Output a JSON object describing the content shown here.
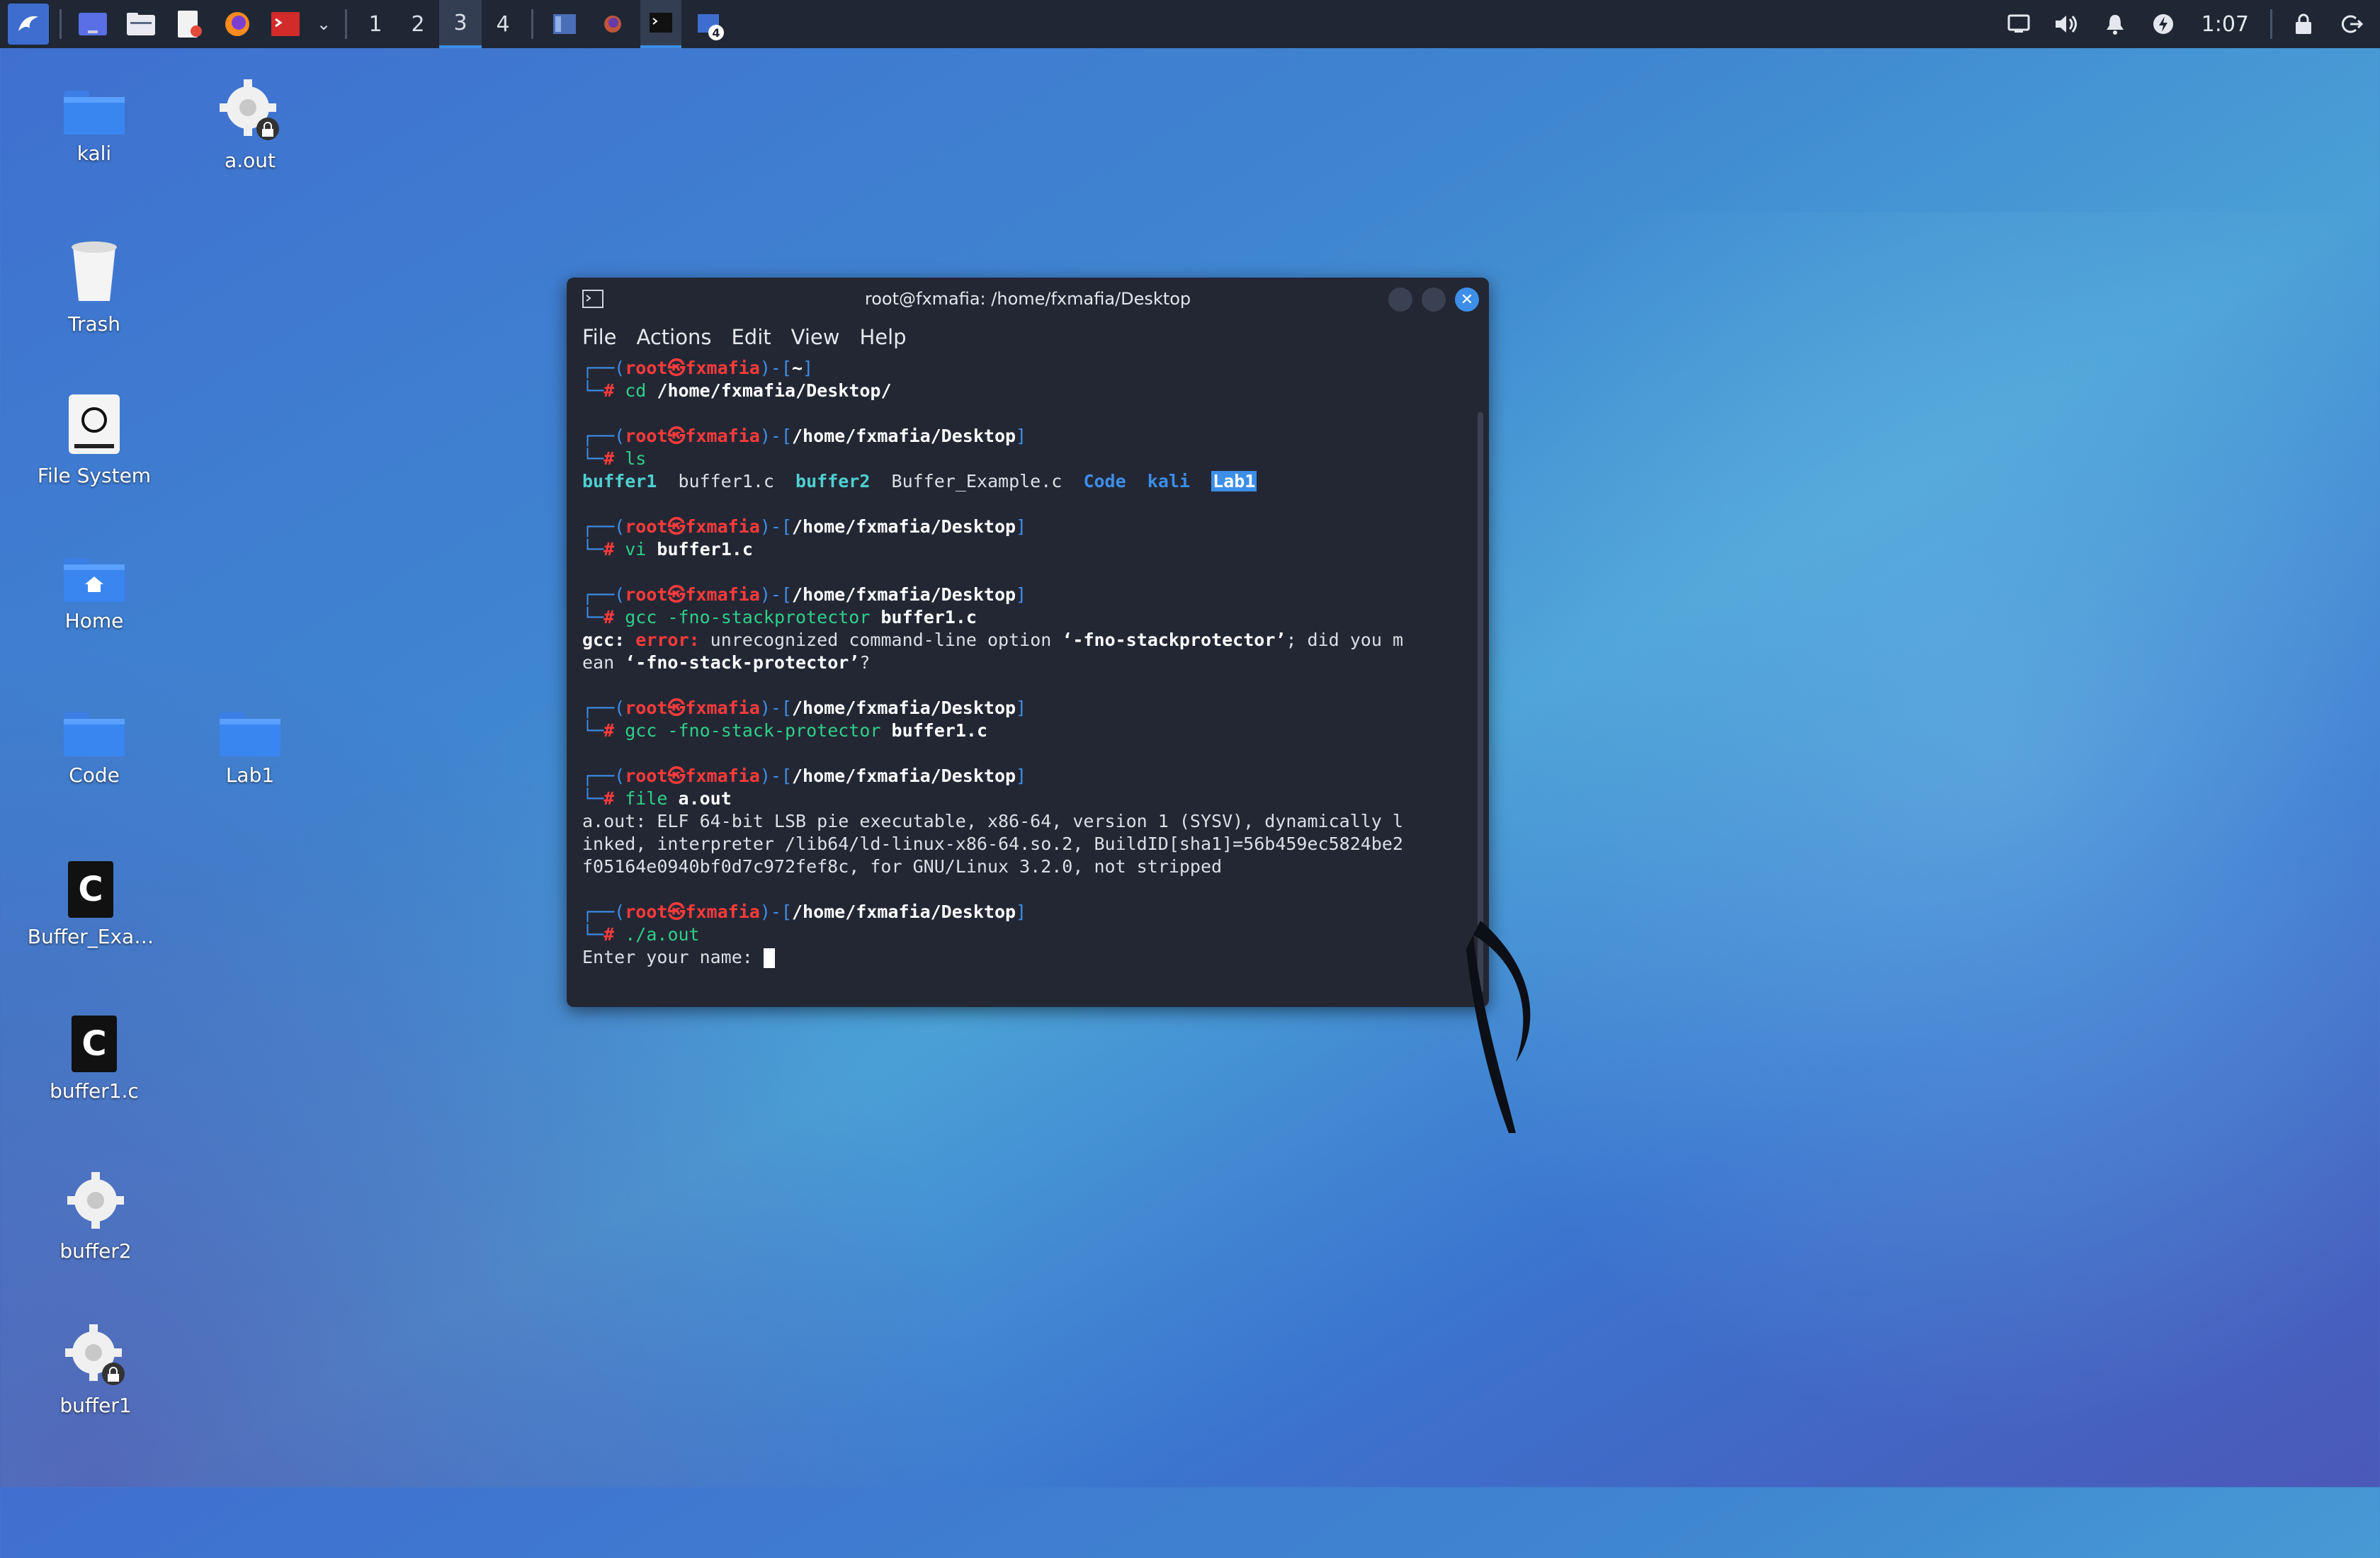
{
  "taskbar": {
    "workspaces": [
      "1",
      "2",
      "3",
      "4"
    ],
    "active_workspace": "3",
    "notification_badge": "4",
    "clock": "1:07"
  },
  "desktop_icons": {
    "kali": "kali",
    "aout": "a.out",
    "trash": "Trash",
    "filesystem": "File System",
    "home": "Home",
    "code": "Code",
    "lab1": "Lab1",
    "buffer_example": "Buffer_Exa…",
    "buffer1c": "buffer1.c",
    "buffer2": "buffer2",
    "buffer1": "buffer1"
  },
  "terminal": {
    "title": "root@fxmafia: /home/fxmafia/Desktop",
    "menu": [
      "File",
      "Actions",
      "Edit",
      "View",
      "Help"
    ],
    "user": "root",
    "host": "fxmafia",
    "home_dir": "~",
    "desktop_dir": "/home/fxmafia/Desktop",
    "cmd1_name": "cd",
    "cmd1_arg": "/home/fxmafia/Desktop/",
    "cmd2": "ls",
    "ls_out": {
      "a": "buffer1",
      "b": "buffer1.c",
      "c": "buffer2",
      "d": "Buffer_Example.c",
      "e": "Code",
      "f": "kali",
      "g": "Lab1"
    },
    "cmd3_name": "vi",
    "cmd3_arg": "buffer1.c",
    "cmd4_name": "gcc -fno-stackprotector",
    "cmd4_arg": "buffer1.c",
    "gcc_err_prefix": "gcc:",
    "gcc_err_word": "error:",
    "gcc_err_text": "unrecognized command-line option",
    "gcc_err_opt": "‘-fno-stackprotector’",
    "gcc_err_tail": "; did you m",
    "gcc_err_line2_a": "ean",
    "gcc_err_line2_b": "‘-fno-stack-protector’",
    "gcc_err_line2_c": "?",
    "cmd5_name": "gcc -fno-stack-protector",
    "cmd5_arg": "buffer1.c",
    "cmd6_name": "file",
    "cmd6_arg": "a.out",
    "file_out_1": "a.out: ELF 64-bit LSB pie executable, x86-64, version 1 (SYSV), dynamically l",
    "file_out_2": "inked, interpreter /lib64/ld-linux-x86-64.so.2, BuildID[sha1]=56b459ec5824be2",
    "file_out_3": "f05164e0940bf0d7c972fef8c, for GNU/Linux 3.2.0, not stripped",
    "cmd7": "./a.out",
    "prompt_line": "Enter your name: "
  },
  "colors": {
    "accent": "#3d8ee9",
    "prompt_red": "#ff3b3b",
    "terminal_bg": "#232734",
    "taskbar_bg": "#1f2734"
  }
}
